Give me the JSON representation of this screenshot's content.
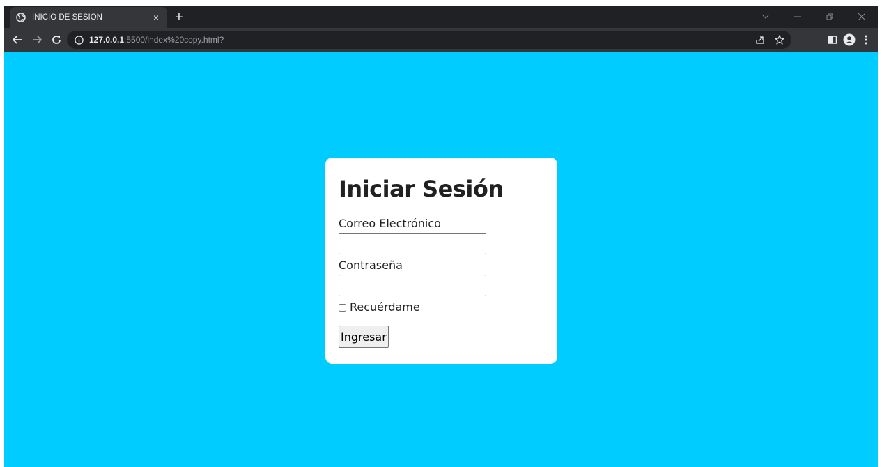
{
  "browser": {
    "tab": {
      "title": "INICIO DE SESION",
      "close": "×"
    },
    "new_tab": "+",
    "url": {
      "host": "127.0.0.1",
      "rest": ":5500/index%20copy.html?"
    }
  },
  "form": {
    "title": "Iniciar Sesión",
    "email_label": "Correo Electrónico",
    "email_value": "",
    "password_label": "Contraseña",
    "password_value": "",
    "remember_label": "Recuérdame",
    "remember_checked": false,
    "submit_label": "Ingresar"
  },
  "colors": {
    "page_background": "#00ccff",
    "card_background": "#ffffff",
    "chrome_dark": "#202124",
    "chrome_toolbar": "#35363a"
  },
  "icons": [
    "globe-icon",
    "close-icon",
    "plus-icon",
    "chevron-down-icon",
    "minimize-icon",
    "restore-icon",
    "window-close-icon",
    "back-arrow-icon",
    "forward-arrow-icon",
    "reload-icon",
    "info-icon",
    "share-icon",
    "star-icon",
    "side-panel-icon",
    "profile-icon",
    "menu-kebab-icon"
  ]
}
